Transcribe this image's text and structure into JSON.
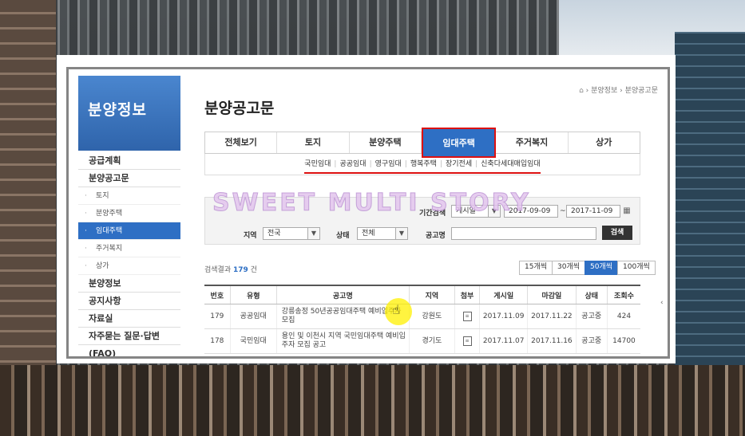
{
  "sidebar": {
    "title": "분양정보",
    "items": [
      {
        "label": "공급계획",
        "level": 1
      },
      {
        "label": "분양공고문",
        "level": 1
      },
      {
        "label": "토지",
        "level": 2
      },
      {
        "label": "분양주택",
        "level": 2
      },
      {
        "label": "임대주택",
        "level": 2,
        "active": true
      },
      {
        "label": "주거복지",
        "level": 2
      },
      {
        "label": "상가",
        "level": 2
      },
      {
        "label": "분양정보",
        "level": 1
      },
      {
        "label": "공지사항",
        "level": 1
      },
      {
        "label": "자료실",
        "level": 1
      },
      {
        "label": "자주묻는 질문·답변(FAQ)",
        "level": 1
      }
    ]
  },
  "breadcrumb": {
    "items": [
      "분양정보",
      "분양공고문"
    ]
  },
  "page_title": "분양공고문",
  "tabs": [
    {
      "label": "전체보기"
    },
    {
      "label": "토지"
    },
    {
      "label": "분양주택"
    },
    {
      "label": "임대주택",
      "active": true
    },
    {
      "label": "주거복지"
    },
    {
      "label": "상가"
    }
  ],
  "subtabs": [
    "국민임대",
    "공공임대",
    "영구임대",
    "행복주택",
    "장기전세",
    "신축다세대매입임대"
  ],
  "watermark": "SWEET MULTI STORY",
  "search": {
    "period_label": "기간검색",
    "period_type": "게시일",
    "date_from": "2017-09-09",
    "date_sep": "~",
    "date_to": "2017-11-09",
    "region_label": "지역",
    "region_value": "전국",
    "status_label": "상태",
    "status_value": "전체",
    "name_label": "공고명",
    "name_value": "",
    "search_button": "검색"
  },
  "results": {
    "prefix": "검색결과",
    "count": "179",
    "suffix": "건"
  },
  "page_sizes": [
    {
      "label": "15개씩"
    },
    {
      "label": "30개씩"
    },
    {
      "label": "50개씩",
      "active": true
    },
    {
      "label": "100개씩"
    }
  ],
  "table": {
    "headers": [
      "번호",
      "유형",
      "공고명",
      "지역",
      "첨부",
      "게시일",
      "마감일",
      "상태",
      "조회수"
    ],
    "rows": [
      {
        "no": "179",
        "type": "공공임대",
        "title_l1": "강릉송정 50년공공임대주택 예비입주자",
        "title_l2": "모집",
        "region": "강원도",
        "posted": "2017.11.09",
        "deadline": "2017.11.22",
        "status": "공고중",
        "views": "424"
      },
      {
        "no": "178",
        "type": "국민임대",
        "title_l1": "용인 및 이천시 지역 국민임대주택 예비입",
        "title_l2": "주자 모집 공고",
        "region": "경기도",
        "posted": "2017.11.07",
        "deadline": "2017.11.16",
        "status": "공고중",
        "views": "14700"
      }
    ]
  },
  "colors": {
    "accent": "#2e6fc4",
    "highlight_border": "#dd1111",
    "sidebar_header": "#3b73b9"
  }
}
